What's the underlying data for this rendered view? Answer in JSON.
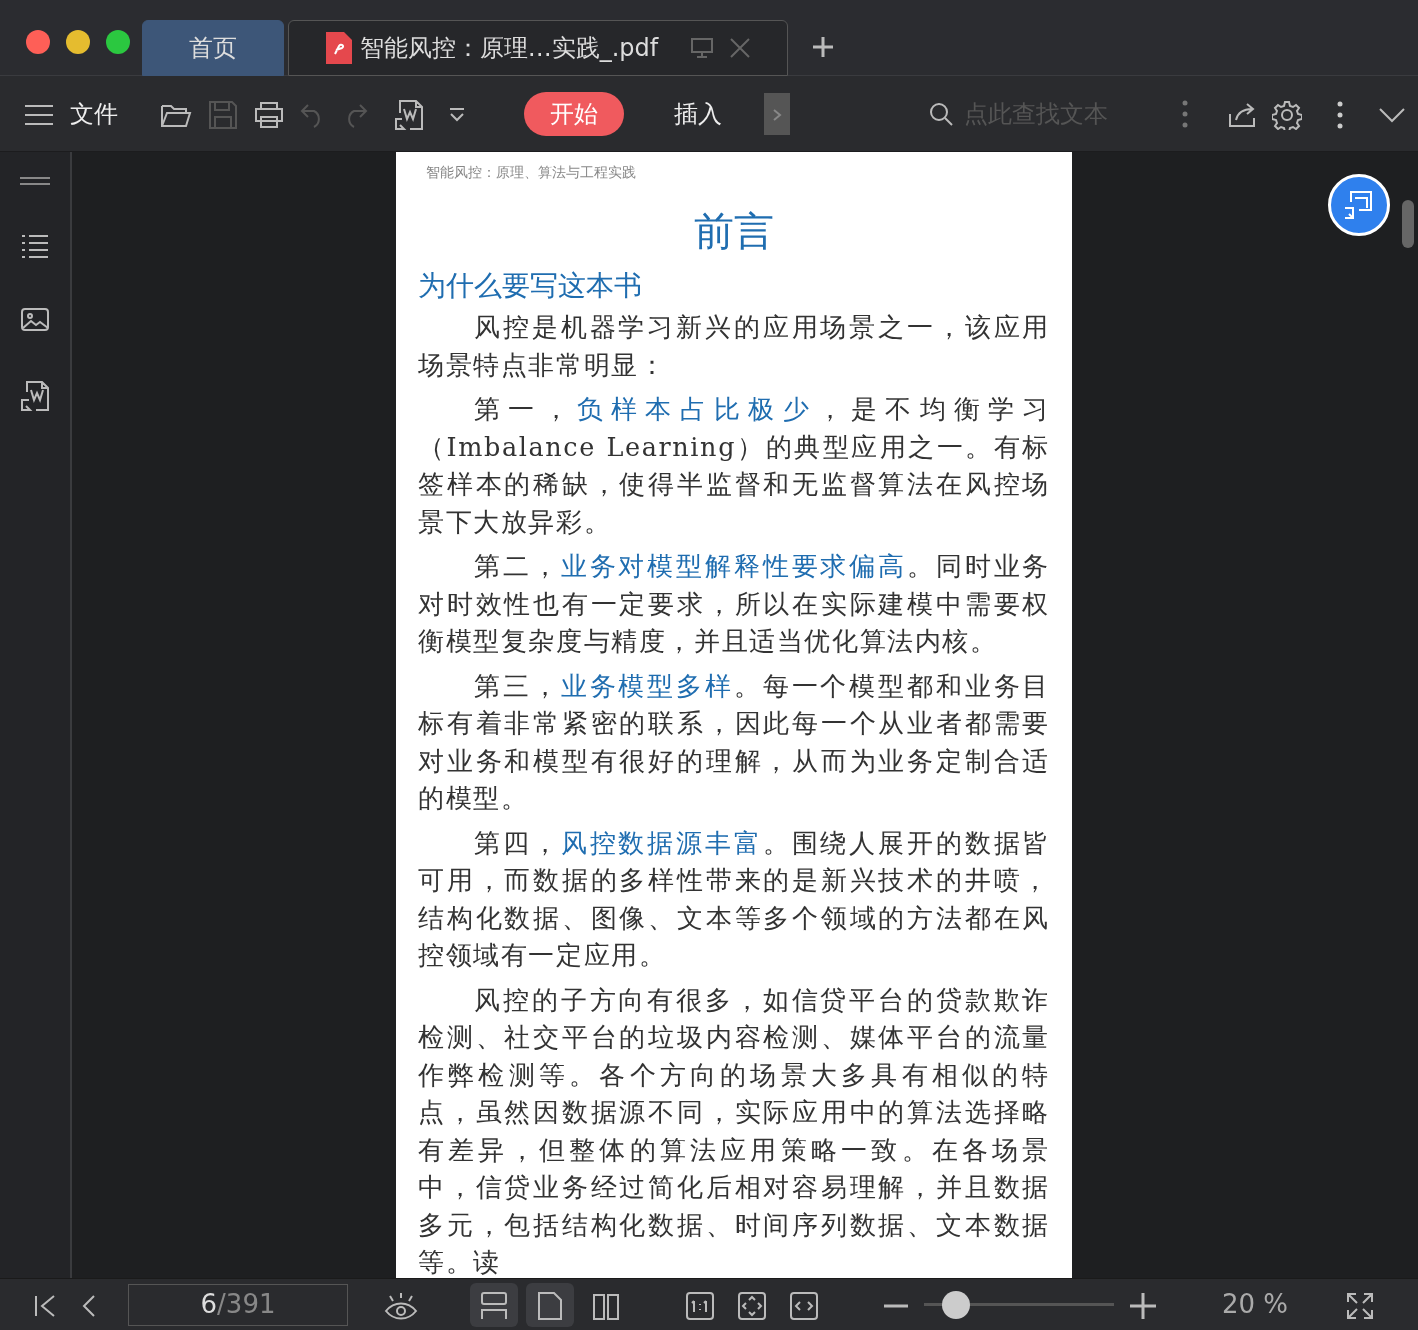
{
  "tabs": [
    {
      "label": "首页",
      "kind": "home",
      "selected": false
    },
    {
      "label": "智能风控：原理…实践_.pdf",
      "kind": "document",
      "selected": true
    }
  ],
  "toolbar": {
    "file_menu": "文件",
    "ribbon_tabs": [
      {
        "label": "开始",
        "selected": true
      },
      {
        "label": "插入",
        "selected": false
      }
    ],
    "search": {
      "placeholder": "点此查找文本"
    }
  },
  "document": {
    "running_header": "智能风控：原理、算法与工程实践",
    "title": "前言",
    "heading": "为什么要写这本书",
    "paragraphs": [
      [
        {
          "text": "风控是机器学习新兴的应用场景之一，该应用场景特点非常明显：",
          "emphasis": false
        }
      ],
      [
        {
          "text": "第一，",
          "emphasis": false
        },
        {
          "text": "负样本占比极少",
          "emphasis": true
        },
        {
          "text": "，是不均衡学习（Imbalance Learning）的典型应用之一。有标签样本的稀缺，使得半监督和无监督算法在风控场景下大放异彩。",
          "emphasis": false
        }
      ],
      [
        {
          "text": "第二，",
          "emphasis": false
        },
        {
          "text": "业务对模型解释性要求偏高",
          "emphasis": true
        },
        {
          "text": "。同时业务对时效性也有一定要求，所以在实际建模中需要权衡模型复杂度与精度，并且适当优化算法内核。",
          "emphasis": false
        }
      ],
      [
        {
          "text": "第三，",
          "emphasis": false
        },
        {
          "text": "业务模型多样",
          "emphasis": true
        },
        {
          "text": "。每一个模型都和业务目标有着非常紧密的联系，因此每一个从业者都需要对业务和模型有很好的理解，从而为业务定制合适的模型。",
          "emphasis": false
        }
      ],
      [
        {
          "text": "第四，",
          "emphasis": false
        },
        {
          "text": "风控数据源丰富",
          "emphasis": true
        },
        {
          "text": "。围绕人展开的数据皆可用，而数据的多样性带来的是新兴技术的井喷，结构化数据、图像、文本等多个领域的方法都在风控领域有一定应用。",
          "emphasis": false
        }
      ],
      [
        {
          "text": "风控的子方向有很多，如信贷平台的贷款欺诈检测、社交平台的垃圾内容检测、媒体平台的流量作弊检测等。各个方向的场景大多具有相似的特点，虽然因数据源不同，实际应用中的算法选择略有差异，但整体的算法应用策略一致。在各场景中，信贷业务经过简化后相对容易理解，并且数据多元，包括结构化数据、时间序列数据、文本数据等。读",
          "emphasis": false
        }
      ]
    ]
  },
  "status_bar": {
    "page_current": "6",
    "page_total": "/391",
    "view_modes": [
      {
        "kind": "continuous",
        "selected": true
      },
      {
        "kind": "single",
        "selected": true
      },
      {
        "kind": "double",
        "selected": false
      }
    ],
    "zoom": {
      "level": 0.17,
      "reading": "20 %"
    }
  }
}
